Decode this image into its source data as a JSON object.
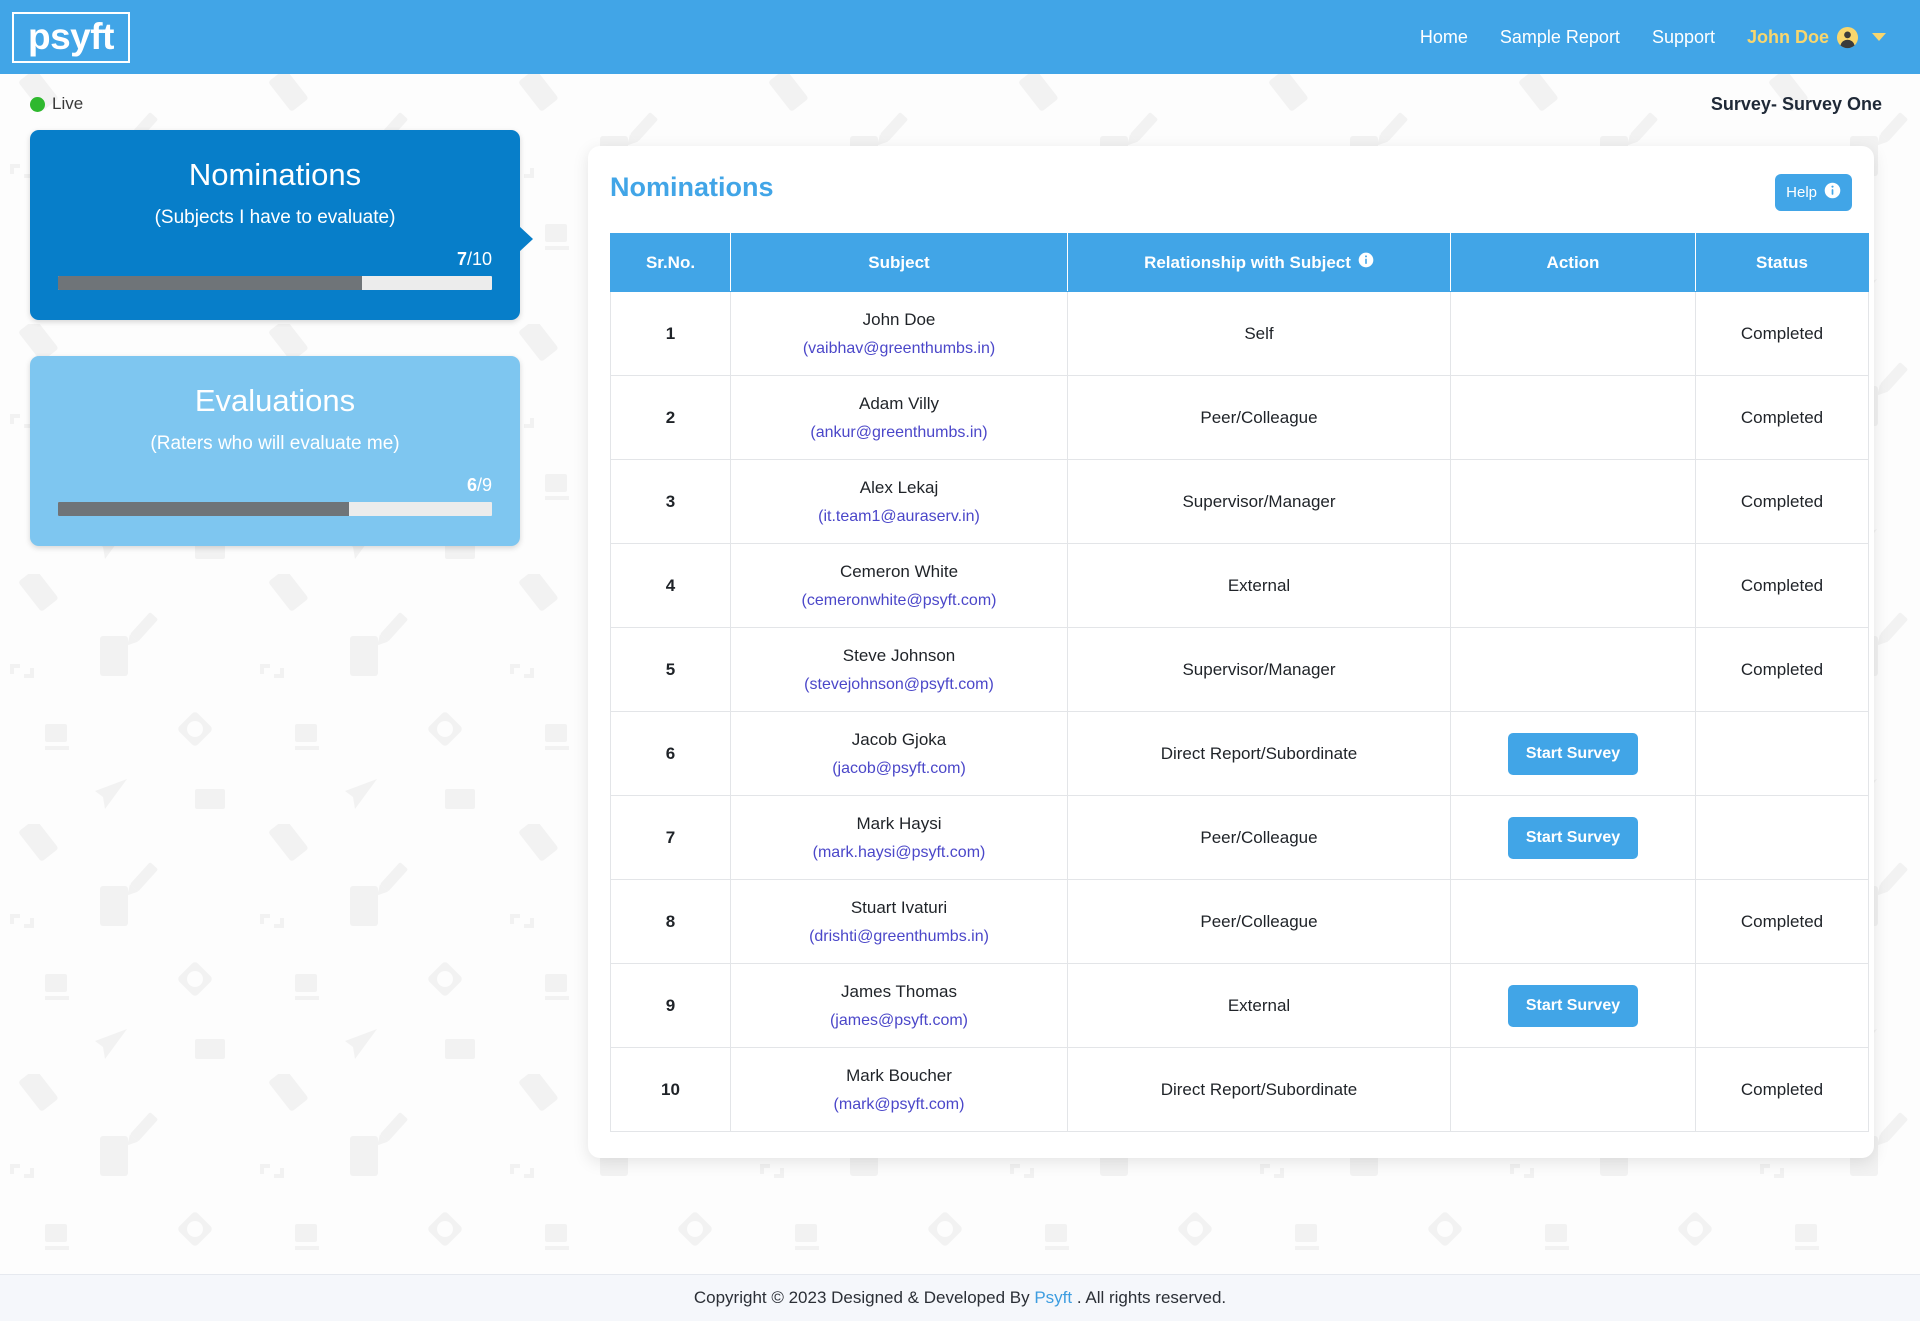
{
  "brand": {
    "name": "psyft"
  },
  "nav": {
    "links": [
      {
        "label": "Home"
      },
      {
        "label": "Sample Report"
      },
      {
        "label": "Support"
      }
    ],
    "user": {
      "name": "John Doe",
      "avatar_icon": "user-circle-icon",
      "caret_icon": "chevron-down-icon"
    }
  },
  "status_bar": {
    "live_label": "Live",
    "live_color": "#2eb82e",
    "survey_label": "Survey- Survey One"
  },
  "cards": [
    {
      "title": "Nominations",
      "subtitle": "(Subjects I have to evaluate)",
      "done": "7",
      "total": "/10",
      "percent": 70,
      "bg": "#077ec9",
      "active": true
    },
    {
      "title": "Evaluations",
      "subtitle": "(Raters who will evaluate me)",
      "done": "6",
      "total": "/9",
      "percent": 67,
      "bg": "#7ec6f0",
      "active": false
    }
  ],
  "panel": {
    "title": "Nominations",
    "help_label": "Help",
    "help_icon": "info-circle-icon",
    "accent": "#41a5e7"
  },
  "table": {
    "headers": [
      "Sr.No.",
      "Subject",
      "Relationship with Subject",
      "Action",
      "Status"
    ],
    "relationship_info_icon": "info-circle-icon",
    "rows": [
      {
        "sr": "1",
        "name": "John Doe",
        "email": "(vaibhav@greenthumbs.in)",
        "relationship": "Self",
        "action": "",
        "status": "Completed"
      },
      {
        "sr": "2",
        "name": "Adam Villy",
        "email": "(ankur@greenthumbs.in)",
        "relationship": "Peer/Colleague",
        "action": "",
        "status": "Completed"
      },
      {
        "sr": "3",
        "name": "Alex Lekaj",
        "email": "(it.team1@auraserv.in)",
        "relationship": "Supervisor/Manager",
        "action": "",
        "status": "Completed"
      },
      {
        "sr": "4",
        "name": "Cemeron White",
        "email": "(cemeronwhite@psyft.com)",
        "relationship": "External",
        "action": "",
        "status": "Completed"
      },
      {
        "sr": "5",
        "name": "Steve Johnson",
        "email": "(stevejohnson@psyft.com)",
        "relationship": "Supervisor/Manager",
        "action": "",
        "status": "Completed"
      },
      {
        "sr": "6",
        "name": "Jacob Gjoka",
        "email": "(jacob@psyft.com)",
        "relationship": "Direct Report/Subordinate",
        "action": "Start Survey",
        "status": ""
      },
      {
        "sr": "7",
        "name": "Mark Haysi",
        "email": "(mark.haysi@psyft.com)",
        "relationship": "Peer/Colleague",
        "action": "Start Survey",
        "status": ""
      },
      {
        "sr": "8",
        "name": "Stuart Ivaturi",
        "email": "(drishti@greenthumbs.in)",
        "relationship": "Peer/Colleague",
        "action": "",
        "status": "Completed"
      },
      {
        "sr": "9",
        "name": "James Thomas",
        "email": "(james@psyft.com)",
        "relationship": "External",
        "action": "Start Survey",
        "status": ""
      },
      {
        "sr": "10",
        "name": "Mark Boucher",
        "email": "(mark@psyft.com)",
        "relationship": "Direct Report/Subordinate",
        "action": "",
        "status": "Completed"
      }
    ]
  },
  "footer": {
    "prefix": "Copyright © 2023 Designed & Developed By",
    "link": "Psyft",
    "suffix": ". All rights reserved."
  }
}
